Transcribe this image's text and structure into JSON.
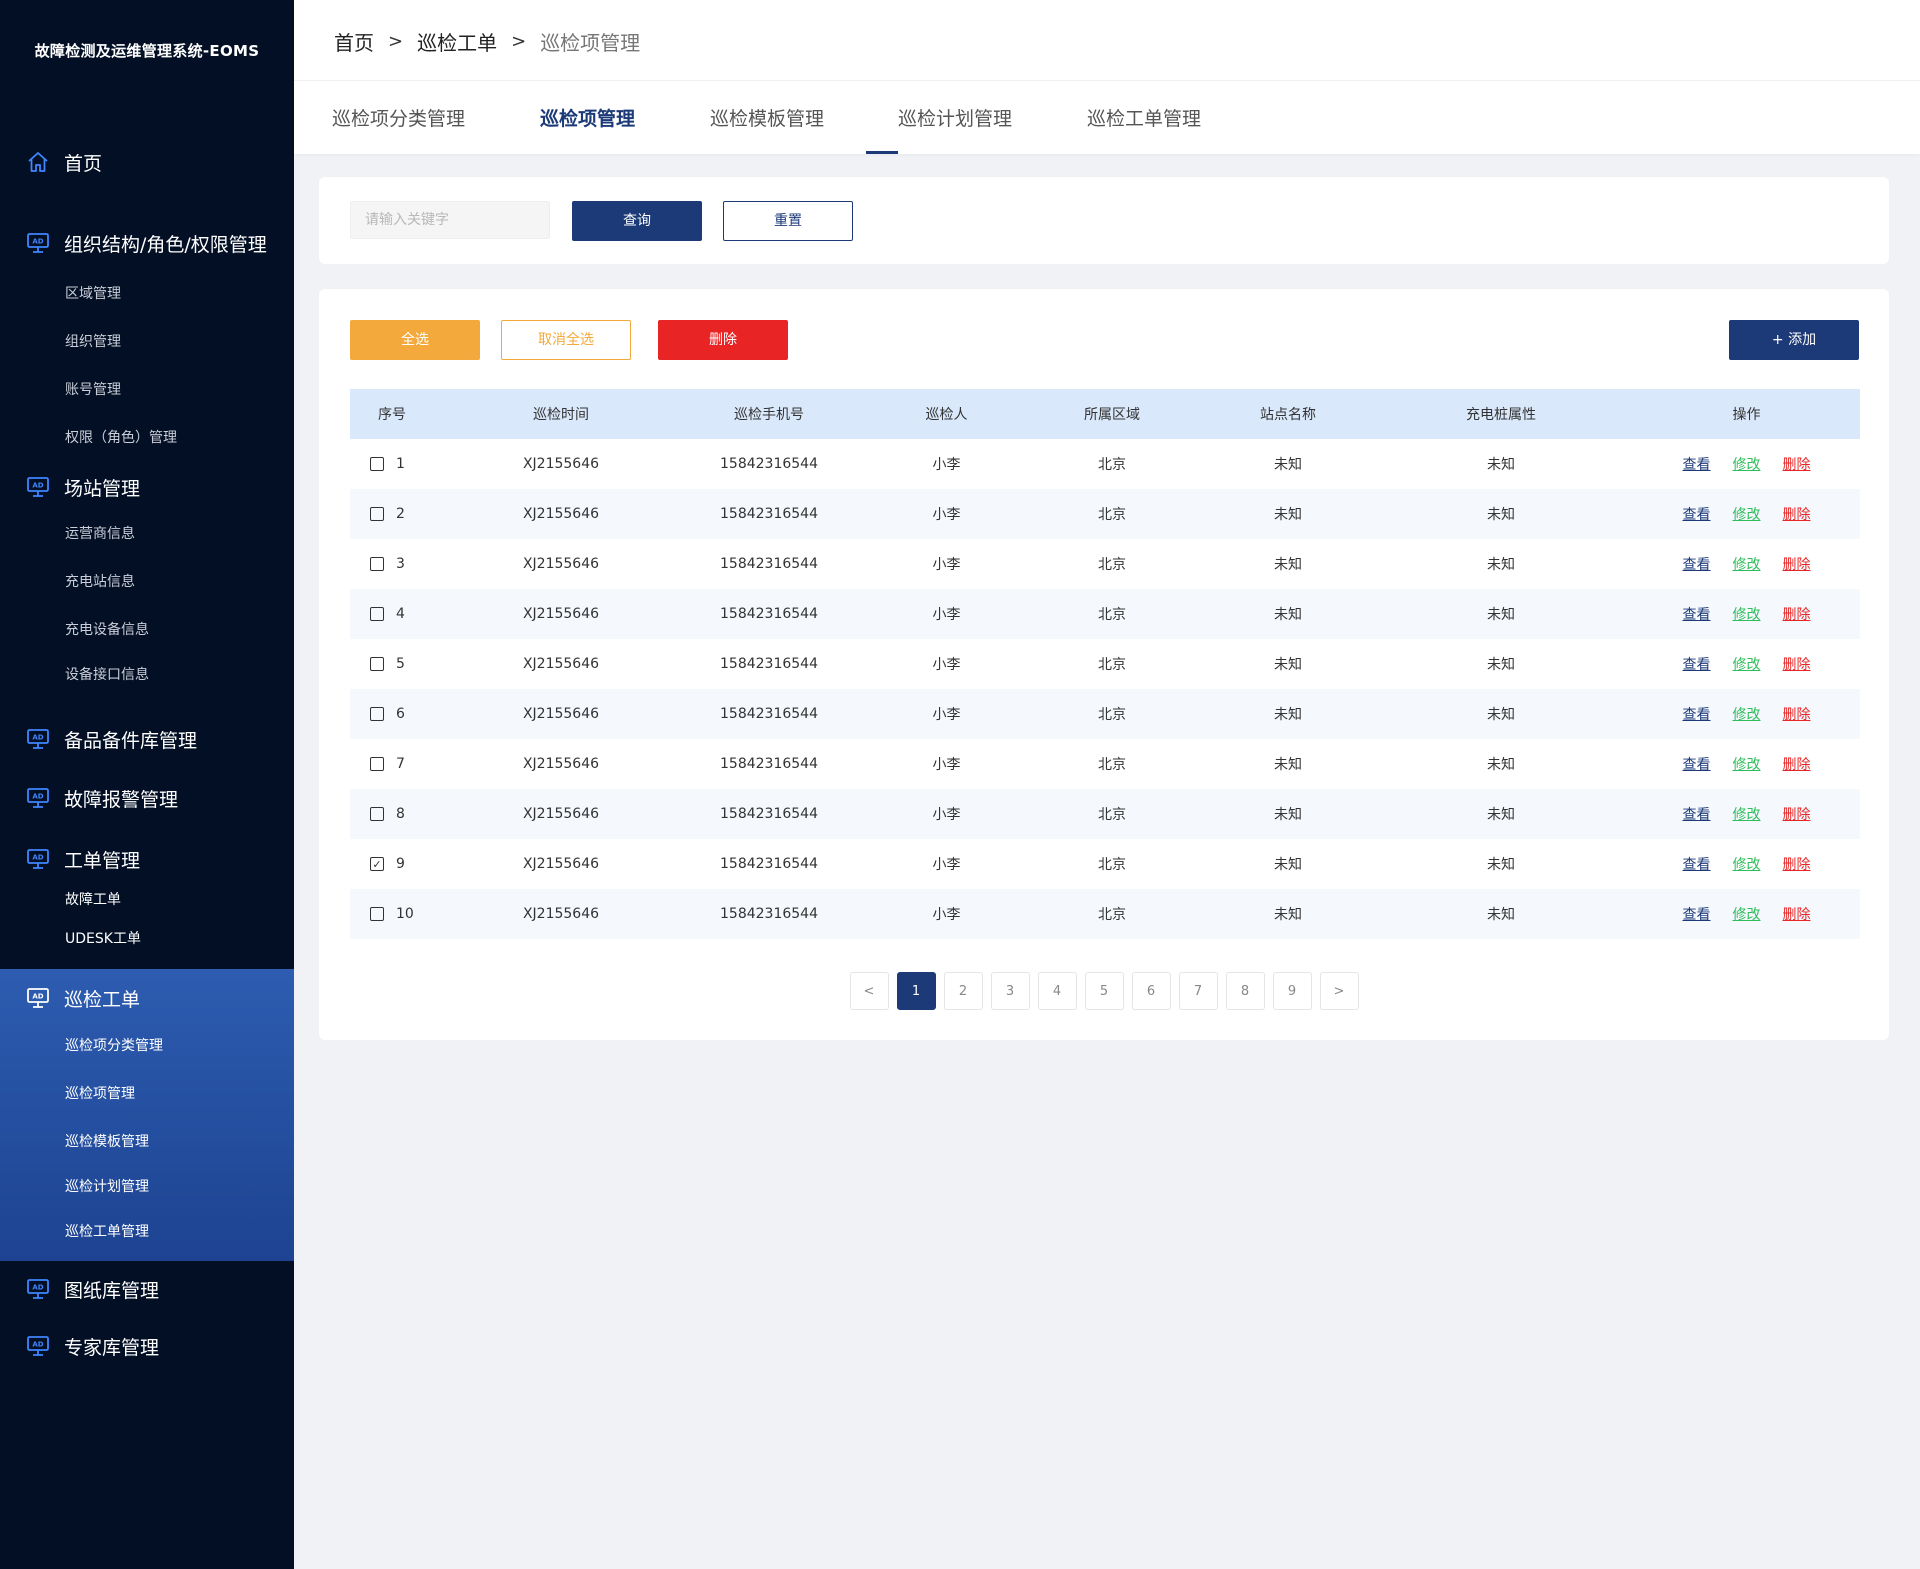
{
  "app": {
    "title": "故障检测及运维管理系统-EOMS"
  },
  "sidebar": {
    "home": "首页",
    "org": {
      "label": "组织结构/角色/权限管理",
      "items": [
        "区域管理",
        "组织管理",
        "账号管理",
        "权限（角色）管理"
      ]
    },
    "station": {
      "label": "场站管理",
      "items": [
        "运营商信息",
        "充电站信息",
        "充电设备信息",
        "设备接口信息"
      ]
    },
    "spare": "备品备件库管理",
    "alarm": "故障报警管理",
    "workorder": {
      "label": "工单管理",
      "items": [
        "故障工单",
        "UDESK工单"
      ]
    },
    "inspection": {
      "label": "巡检工单",
      "items": [
        "巡检项分类管理",
        "巡检项管理",
        "巡检模板管理",
        "巡检计划管理",
        "巡检工单管理"
      ]
    },
    "drawings": "图纸库管理",
    "experts": "专家库管理"
  },
  "breadcrumb": {
    "home": "首页",
    "parent": "巡检工单",
    "current": "巡检项管理",
    "sep": ">"
  },
  "tabs": [
    "巡检项分类管理",
    "巡检项管理",
    "巡检模板管理",
    "巡检计划管理",
    "巡检工单管理"
  ],
  "active_tab": "巡检项管理",
  "search": {
    "placeholder": "请输入关键字",
    "value": "",
    "query_label": "查询",
    "reset_label": "重置"
  },
  "toolbar": {
    "select_all": "全选",
    "deselect_all": "取消全选",
    "delete": "删除",
    "add": "+ 添加"
  },
  "table": {
    "headers": [
      "序号",
      "巡检时间",
      "巡检手机号",
      "巡检人",
      "所属区域",
      "站点名称",
      "充电桩属性",
      "操作"
    ],
    "actions": {
      "view": "查看",
      "edit": "修改",
      "delete": "删除"
    },
    "rows": [
      {
        "checked": false,
        "no": "1",
        "time": "XJ2155646",
        "phone": "15842316544",
        "inspector": "小李",
        "region": "北京",
        "site": "未知",
        "pile_attr": "未知"
      },
      {
        "checked": false,
        "no": "2",
        "time": "XJ2155646",
        "phone": "15842316544",
        "inspector": "小李",
        "region": "北京",
        "site": "未知",
        "pile_attr": "未知"
      },
      {
        "checked": false,
        "no": "3",
        "time": "XJ2155646",
        "phone": "15842316544",
        "inspector": "小李",
        "region": "北京",
        "site": "未知",
        "pile_attr": "未知"
      },
      {
        "checked": false,
        "no": "4",
        "time": "XJ2155646",
        "phone": "15842316544",
        "inspector": "小李",
        "region": "北京",
        "site": "未知",
        "pile_attr": "未知"
      },
      {
        "checked": false,
        "no": "5",
        "time": "XJ2155646",
        "phone": "15842316544",
        "inspector": "小李",
        "region": "北京",
        "site": "未知",
        "pile_attr": "未知"
      },
      {
        "checked": false,
        "no": "6",
        "time": "XJ2155646",
        "phone": "15842316544",
        "inspector": "小李",
        "region": "北京",
        "site": "未知",
        "pile_attr": "未知"
      },
      {
        "checked": false,
        "no": "7",
        "time": "XJ2155646",
        "phone": "15842316544",
        "inspector": "小李",
        "region": "北京",
        "site": "未知",
        "pile_attr": "未知"
      },
      {
        "checked": false,
        "no": "8",
        "time": "XJ2155646",
        "phone": "15842316544",
        "inspector": "小李",
        "region": "北京",
        "site": "未知",
        "pile_attr": "未知"
      },
      {
        "checked": true,
        "no": "9",
        "time": "XJ2155646",
        "phone": "15842316544",
        "inspector": "小李",
        "region": "北京",
        "site": "未知",
        "pile_attr": "未知"
      },
      {
        "checked": false,
        "no": "10",
        "time": "XJ2155646",
        "phone": "15842316544",
        "inspector": "小李",
        "region": "北京",
        "site": "未知",
        "pile_attr": "未知"
      }
    ]
  },
  "pagination": {
    "prev": "<",
    "next": ">",
    "pages": [
      "1",
      "2",
      "3",
      "4",
      "5",
      "6",
      "7",
      "8",
      "9"
    ],
    "current": "1"
  },
  "colors": {
    "sidebar_bg": "#020f24",
    "primary": "#1c3a78",
    "orange": "#f3a93b",
    "red": "#e82424",
    "green": "#2ebd5a",
    "active_group": "#2d5cb0",
    "table_header": "#dae8fb"
  },
  "icons": {
    "home": "home-icon",
    "module": "monitor-ad-icon"
  }
}
